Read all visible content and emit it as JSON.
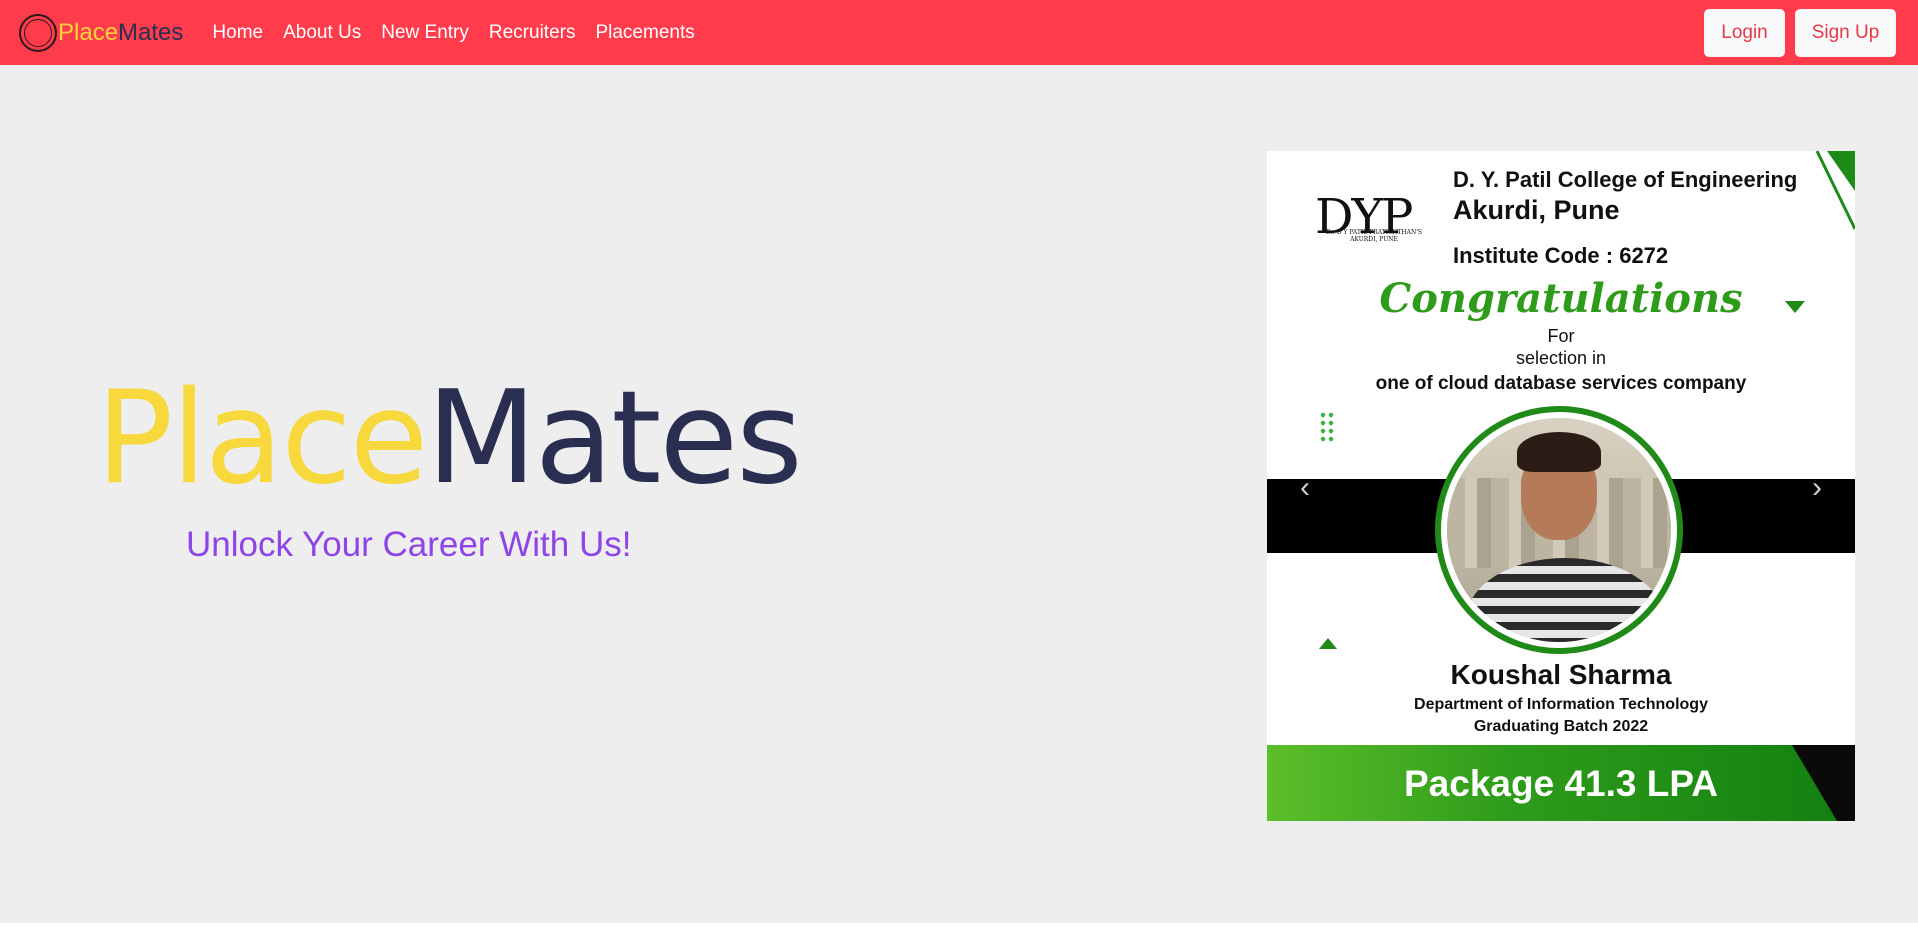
{
  "navbar": {
    "brand_place": "Place",
    "brand_mates": "Mates",
    "links": [
      "Home",
      "About Us",
      "New Entry",
      "Recruiters",
      "Placements"
    ],
    "login_label": "Login",
    "signup_label": "Sign Up"
  },
  "hero": {
    "title_place": "Place",
    "title_mates": "Mates",
    "subtitle": "Unlock Your Career With Us!"
  },
  "carousel": {
    "logo_text": "DYP",
    "logo_sub": "Dr. D Y PATIL PRATISHTHAN'S AKURDI, PUNE",
    "college": "D. Y. Patil College of Engineering",
    "city": "Akurdi, Pune",
    "institute_code": "Institute Code : 6272",
    "congrats": "Congratulations",
    "for": "For",
    "selection": "selection in",
    "company": "one of cloud database  services company",
    "student_name": "Koushal Sharma",
    "department": "Department of Information Technology",
    "batch": "Graduating Batch 2022",
    "package": "Package 41.3 LPA",
    "prev_icon": "‹",
    "next_icon": "›"
  },
  "colors": {
    "navbar_bg": "#ff3b4c",
    "brand_yellow": "#f7d83d",
    "brand_navy": "#2a2f52",
    "subtitle_purple": "#8e44e6",
    "hero_bg": "#eeeeee",
    "accent_green": "#1f8a17"
  }
}
